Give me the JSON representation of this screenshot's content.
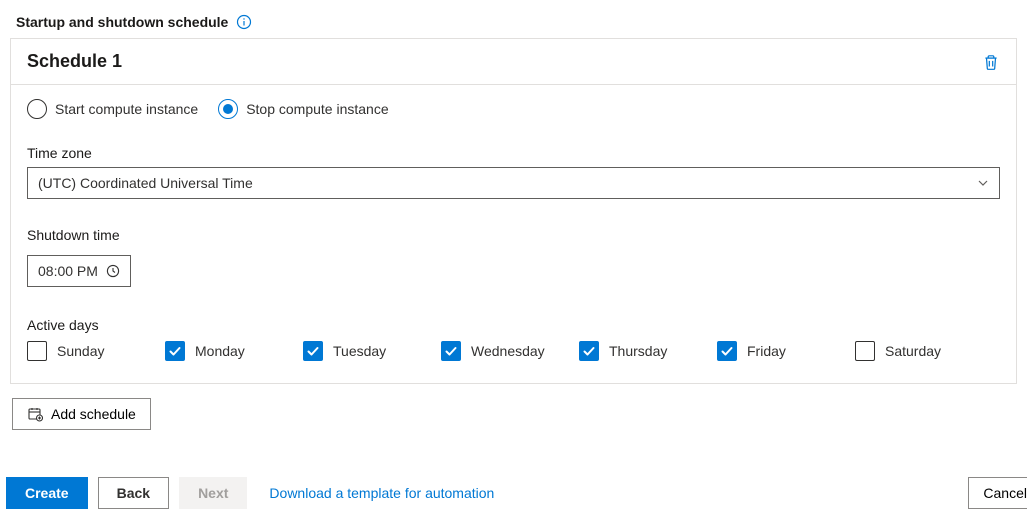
{
  "header": {
    "title": "Startup and shutdown schedule"
  },
  "schedule": {
    "title": "Schedule 1",
    "radios": {
      "start_label": "Start compute instance",
      "stop_label": "Stop compute instance"
    },
    "timezone_label": "Time zone",
    "timezone_value": "(UTC) Coordinated Universal Time",
    "shutdown_label": "Shutdown time",
    "shutdown_value": "08:00 PM",
    "active_days_label": "Active days",
    "days": [
      {
        "label": "Sunday",
        "checked": false
      },
      {
        "label": "Monday",
        "checked": true
      },
      {
        "label": "Tuesday",
        "checked": true
      },
      {
        "label": "Wednesday",
        "checked": true
      },
      {
        "label": "Thursday",
        "checked": true
      },
      {
        "label": "Friday",
        "checked": true
      },
      {
        "label": "Saturday",
        "checked": false
      }
    ]
  },
  "add_schedule_label": "Add schedule",
  "footer": {
    "create": "Create",
    "back": "Back",
    "next": "Next",
    "download_link": "Download a template for automation",
    "cancel": "Cancel"
  }
}
